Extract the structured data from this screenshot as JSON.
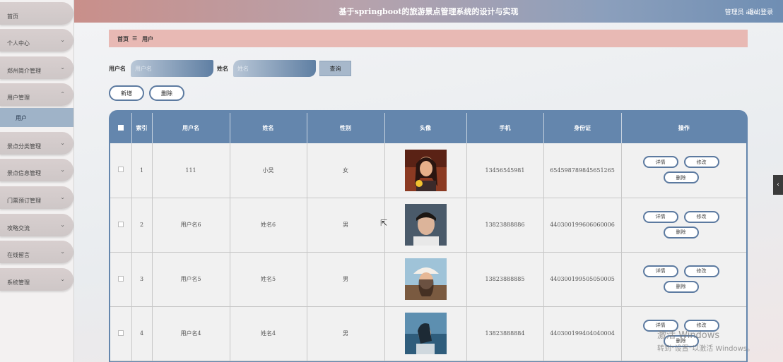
{
  "header": {
    "title": "基于springboot的旅游景点管理系统的设计与实现",
    "user": "管理员 abo",
    "logout": "退出登录"
  },
  "sidebar": {
    "items": [
      {
        "label": "首页",
        "chevron": ""
      },
      {
        "label": "个人中心",
        "chevron": "⌄"
      },
      {
        "label": "郑州简介管理",
        "chevron": "⌄"
      },
      {
        "label": "用户管理",
        "chevron": "⌃"
      },
      {
        "label": "景点分类管理",
        "chevron": "⌄"
      },
      {
        "label": "景点信息管理",
        "chevron": "⌄"
      },
      {
        "label": "门票预订管理",
        "chevron": "⌄"
      },
      {
        "label": "攻略交流",
        "chevron": "⌄"
      },
      {
        "label": "在线留言",
        "chevron": "⌄"
      },
      {
        "label": "系统管理",
        "chevron": "⌄"
      }
    ],
    "sub_item": "用户"
  },
  "breadcrumb": {
    "home": "首页",
    "sep": "☰",
    "current": "用户"
  },
  "search": {
    "username_label": "用户名",
    "username_placeholder": "用户名",
    "name_label": "姓名",
    "name_placeholder": "姓名",
    "query_label": "查询"
  },
  "actions": {
    "add_label": "新增",
    "delete_label": "删除"
  },
  "table": {
    "headers": [
      "索引",
      "用户名",
      "姓名",
      "性别",
      "头像",
      "手机",
      "身份证",
      "操作"
    ],
    "op_detail": "详情",
    "op_edit": "修改",
    "op_delete": "删除",
    "rows": [
      {
        "index": "1",
        "username": "111",
        "name": "小吴",
        "gender": "女",
        "phone": "13456545981",
        "id_card": "654598789845651265"
      },
      {
        "index": "2",
        "username": "用户名6",
        "name": "姓名6",
        "gender": "男",
        "phone": "13823888886",
        "id_card": "440300199606060006"
      },
      {
        "index": "3",
        "username": "用户名5",
        "name": "姓名5",
        "gender": "男",
        "phone": "13823888885",
        "id_card": "440300199505050005"
      },
      {
        "index": "4",
        "username": "用户名4",
        "name": "姓名4",
        "gender": "男",
        "phone": "13823888884",
        "id_card": "440300199404040004"
      }
    ]
  },
  "watermark": {
    "line1": "激活 Windows",
    "line2": "转到\"设置\"以激活 Windows。"
  },
  "icons": {
    "side_handle": "chevron-left-icon",
    "checkbox": "checkbox-icon",
    "cursor": "mouse-cursor-icon"
  }
}
